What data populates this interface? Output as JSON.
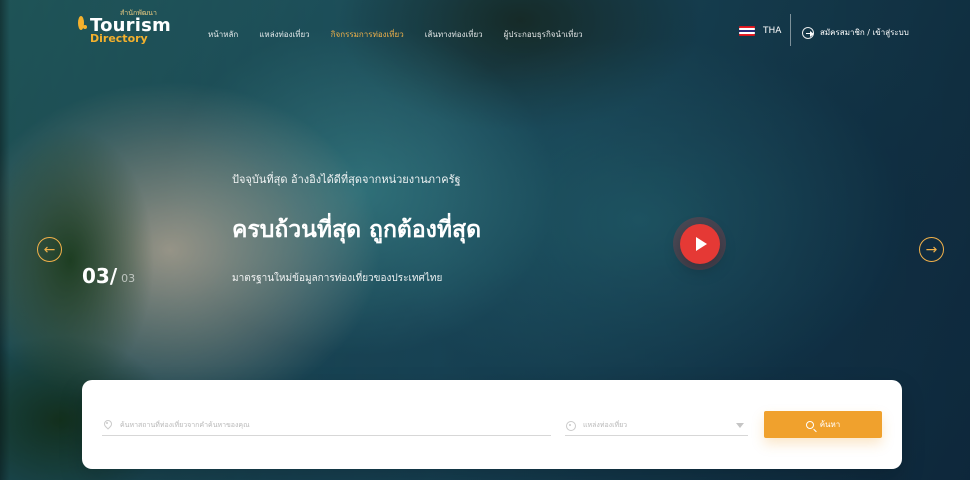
{
  "brand": {
    "logo_small": "สำนักพัฒนา",
    "logo_main": "Tourism",
    "logo_sub": "Directory"
  },
  "nav": {
    "items": [
      {
        "label": "หน้าหลัก",
        "active": false
      },
      {
        "label": "แหล่งท่องเที่ยว",
        "active": false
      },
      {
        "label": "กิจกรรมการท่องเที่ยว",
        "active": true
      },
      {
        "label": "เส้นทางท่องเที่ยว",
        "active": false
      },
      {
        "label": "ผู้ประกอบธุรกิจนำเที่ยว",
        "active": false
      }
    ]
  },
  "topbar": {
    "language": "THA",
    "auth_label": "สมัครสมาชิก / เข้าสู่ระบบ"
  },
  "hero": {
    "subtitle": "ปัจจุบันที่สุด อ้างอิงได้ดีที่สุดจากหน่วยงานภาครัฐ",
    "title": "ครบถ้วนที่สุด ถูกต้องที่สุด",
    "description": "มาตรฐานใหม่ข้อมูลการท่องเที่ยวของประเทศไทย",
    "counter_current": "03/",
    "counter_total": "03"
  },
  "search": {
    "keyword_placeholder": "ค้นหาสถานที่ท่องเที่ยวจากคำค้นหาของคุณ",
    "category_placeholder": "แหล่งท่องเที่ยว",
    "button_label": "ค้นหา"
  },
  "icons": {
    "prev": "arrow-left-icon",
    "next": "arrow-right-icon",
    "play": "play-icon",
    "login": "login-icon",
    "pin": "location-pin-icon",
    "category": "gear-icon",
    "search": "search-icon"
  },
  "colors": {
    "accent": "#f0a12d",
    "play_red": "#e53935"
  }
}
